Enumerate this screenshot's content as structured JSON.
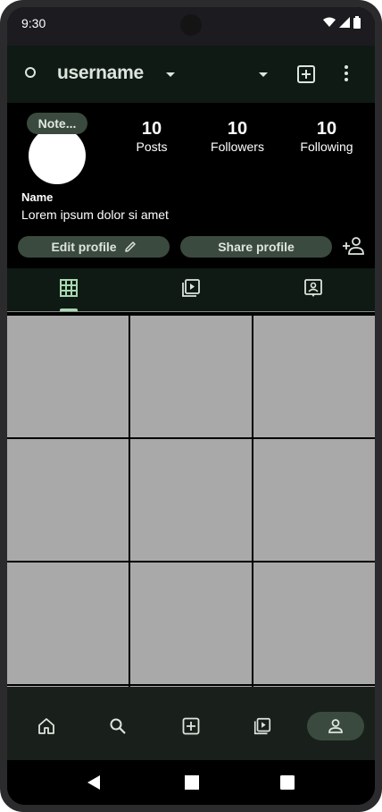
{
  "status_bar": {
    "time": "9:30"
  },
  "app_bar": {
    "username": "username"
  },
  "profile": {
    "note_label": "Note...",
    "stats": [
      {
        "value": "10",
        "label": "Posts"
      },
      {
        "value": "10",
        "label": "Followers"
      },
      {
        "value": "10",
        "label": "Following"
      }
    ],
    "name": "Name",
    "bio": "Lorem ipsum dolor si amet",
    "edit_profile_label": "Edit profile",
    "share_profile_label": "Share profile"
  },
  "tabs": [
    {
      "icon": "grid-icon",
      "selected": true
    },
    {
      "icon": "reels-icon",
      "selected": false
    },
    {
      "icon": "tagged-icon",
      "selected": false
    }
  ],
  "bottom_nav": [
    {
      "icon": "home-icon"
    },
    {
      "icon": "search-icon"
    },
    {
      "icon": "add-post-icon"
    },
    {
      "icon": "reels-icon"
    },
    {
      "icon": "profile-icon",
      "active": true
    }
  ],
  "colors": {
    "chip": "#3b4a3e",
    "app_bar": "#0f1a14",
    "grid_cell": "#a9a9a9",
    "accent": "#a8d8b0"
  }
}
